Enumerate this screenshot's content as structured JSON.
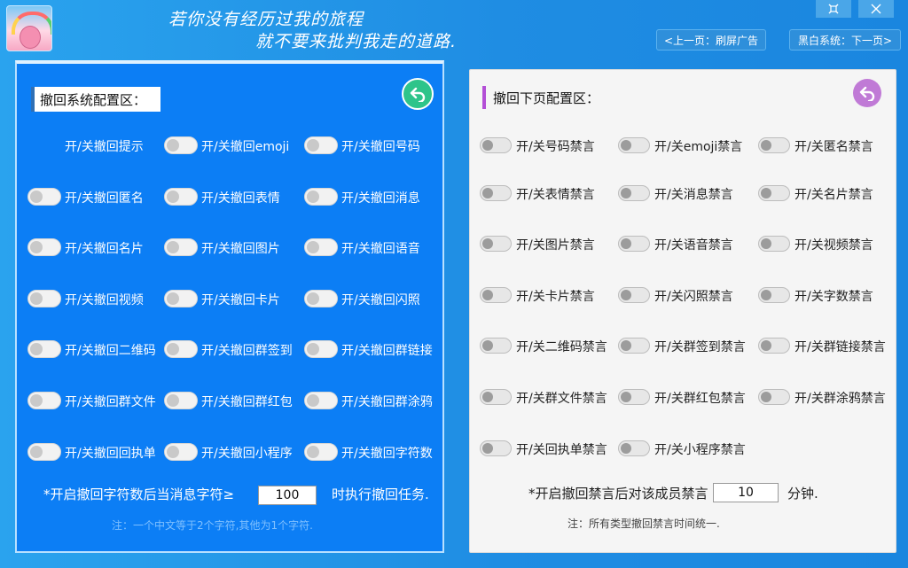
{
  "header": {
    "slogan_line1": "若你没有经历过我的旅程",
    "slogan_line2": "就不要来批判我走的道路.",
    "restore_icon": "restore-icon",
    "close_icon": "close-icon",
    "prev_label": "<上一页：刷屏广告",
    "next_label": "黑白系统：下一页>"
  },
  "left_panel": {
    "title": "撤回系统配置区：",
    "back_icon": "undo-arrow-icon",
    "accent_color": "#0c7ef5",
    "toggles": [
      "开/关撤回提示",
      "开/关撤回emoji",
      "开/关撤回号码",
      "开/关撤回匿名",
      "开/关撤回表情",
      "开/关撤回消息",
      "开/关撤回名片",
      "开/关撤回图片",
      "开/关撤回语音",
      "开/关撤回视频",
      "开/关撤回卡片",
      "开/关撤回闪照",
      "开/关撤回二维码",
      "开/关撤回群签到",
      "开/关撤回群链接",
      "开/关撤回群文件",
      "开/关撤回群红包",
      "开/关撤回群涂鸦",
      "开/关撤回回执单",
      "开/关撤回小程序",
      "开/关撤回字符数"
    ],
    "char_note_prefix": "*开启撤回字符数后当消息字符≥",
    "char_value": "100",
    "char_note_suffix": "时执行撤回任务.",
    "hint": "注：一个中文等于2个字符,其他为1个字符."
  },
  "right_panel": {
    "title": "撤回下页配置区：",
    "back_icon": "undo-arrow-icon",
    "toggles": [
      "开/关号码禁言",
      "开/关emoji禁言",
      "开/关匿名禁言",
      "开/关表情禁言",
      "开/关消息禁言",
      "开/关名片禁言",
      "开/关图片禁言",
      "开/关语音禁言",
      "开/关视频禁言",
      "开/关卡片禁言",
      "开/关闪照禁言",
      "开/关字数禁言",
      "开/关二维码禁言",
      "开/关群签到禁言",
      "开/关群链接禁言",
      "开/关群文件禁言",
      "开/关群红包禁言",
      "开/关群涂鸦禁言",
      "开/关回执单禁言",
      "开/关小程序禁言"
    ],
    "mute_note_prefix": "*开启撤回禁言后对该成员禁言",
    "mute_value": "10",
    "mute_note_suffix": "分钟.",
    "hint": "注：所有类型撤回禁言时间统一."
  }
}
